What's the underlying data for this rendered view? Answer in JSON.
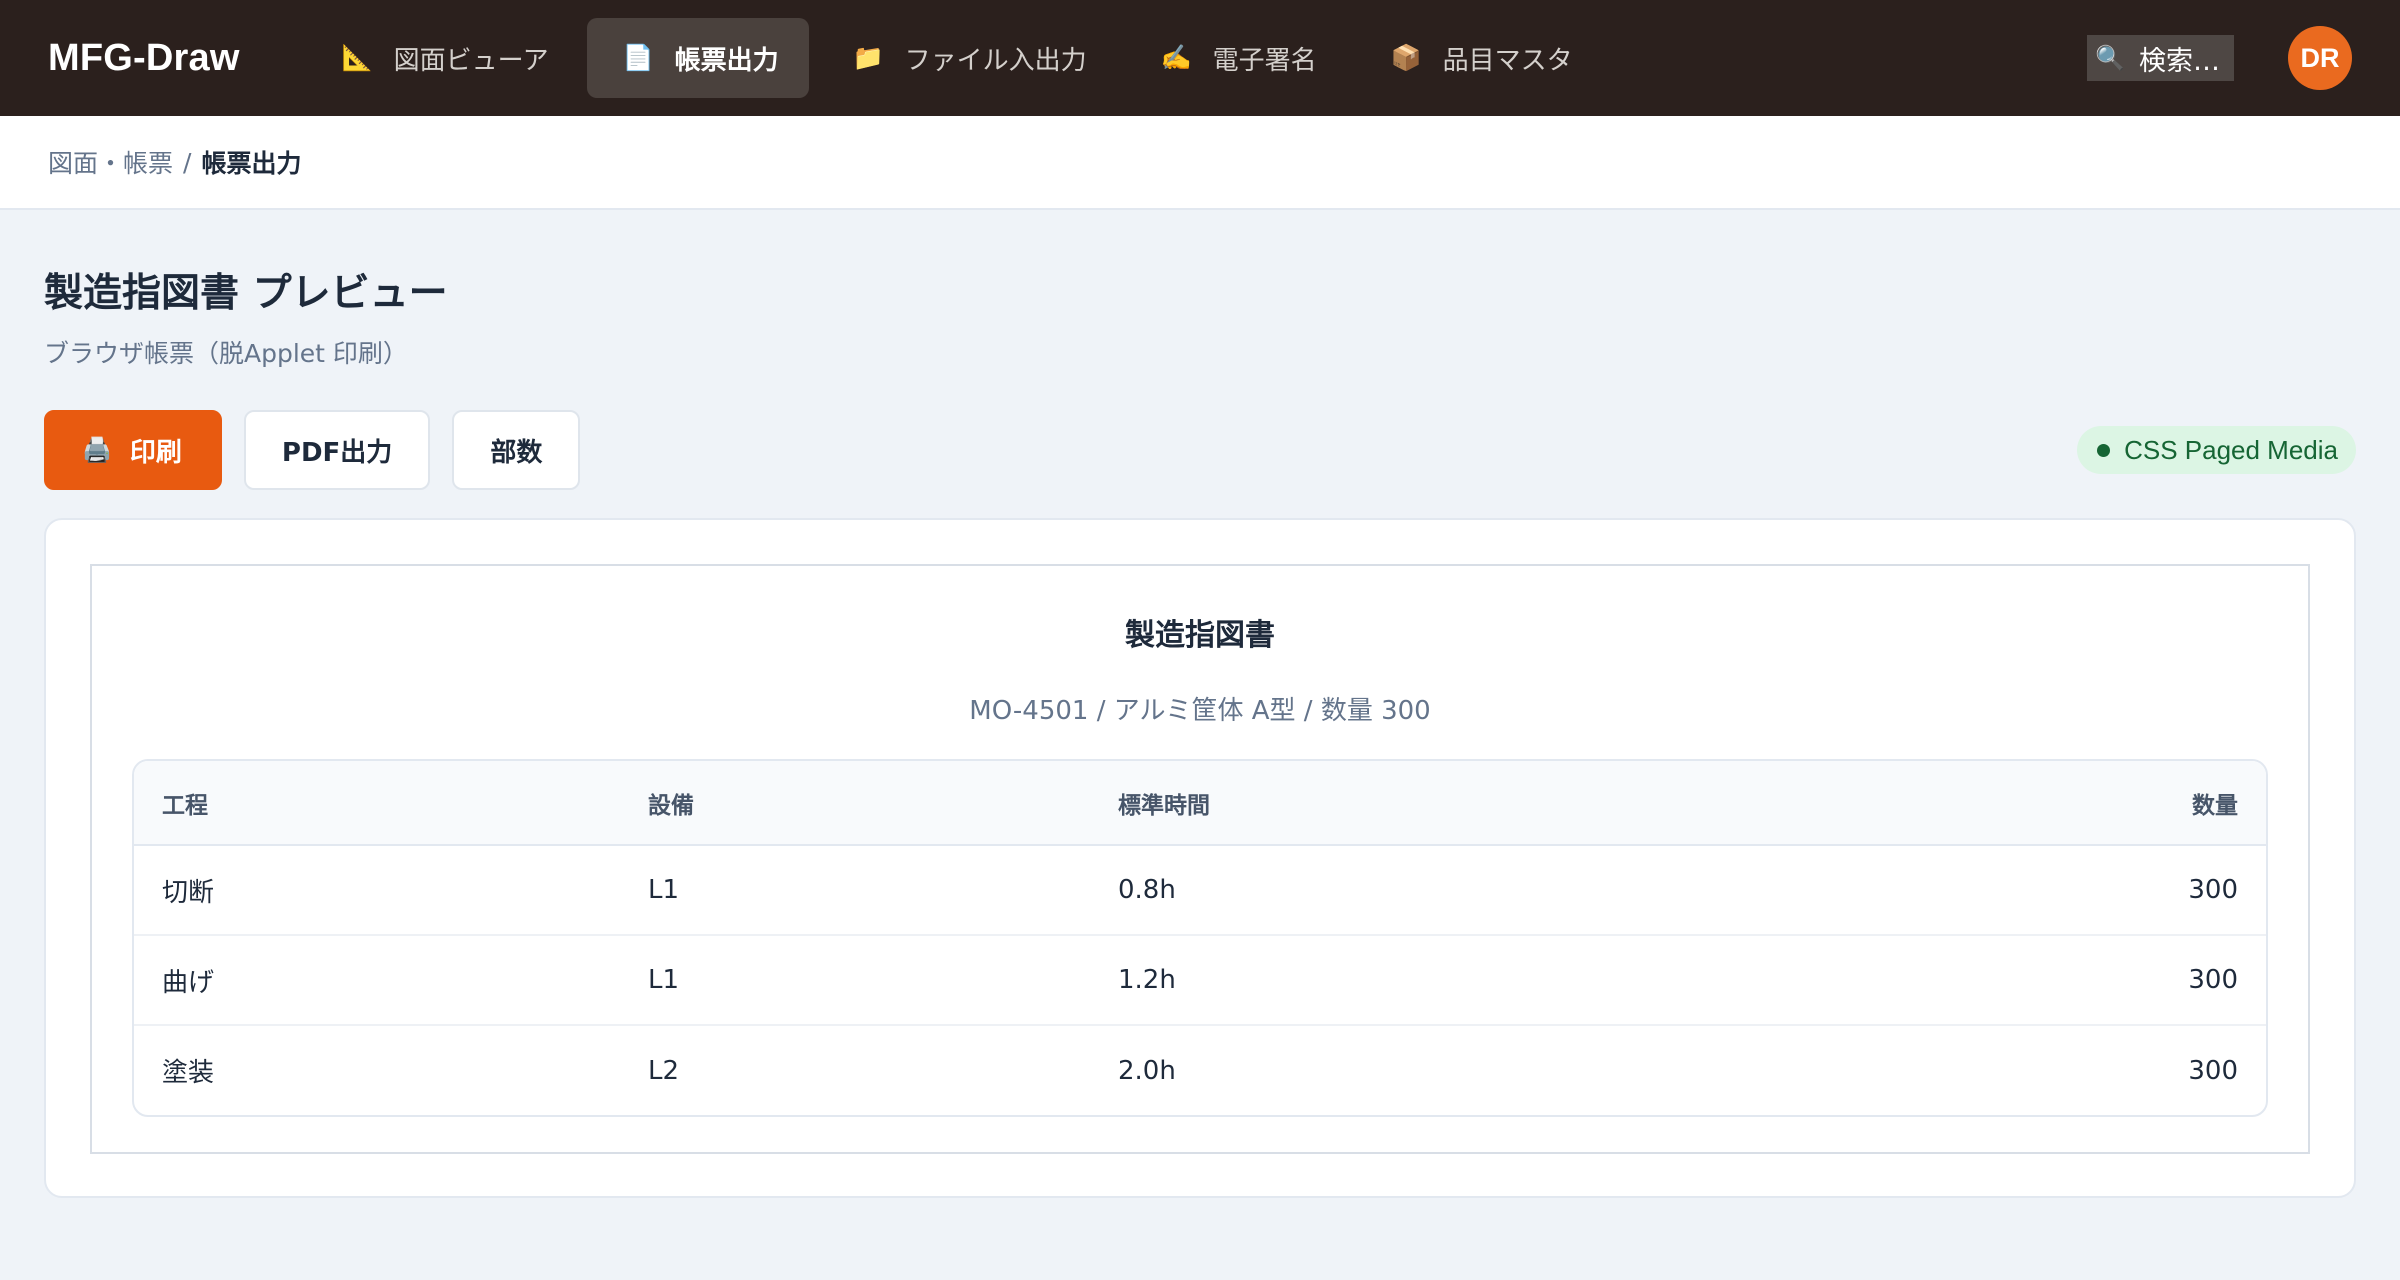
{
  "app": {
    "brand": "MFG-Draw",
    "nav": [
      {
        "label": "図面ビューア",
        "icon": "📐"
      },
      {
        "label": "帳票出力",
        "icon": "📄",
        "active": true
      },
      {
        "label": "ファイル入出力",
        "icon": "📁"
      },
      {
        "label": "電子署名",
        "icon": "✍️"
      },
      {
        "label": "品目マスタ",
        "icon": "📦"
      }
    ],
    "search_label": "検索…",
    "search_icon": "🔍",
    "avatar_initials": "DR"
  },
  "breadcrumb": {
    "parent": "図面・帳票",
    "separator": "/",
    "current": "帳票出力"
  },
  "page": {
    "title": "製造指図書 プレビュー",
    "subtitle": "ブラウザ帳票（脱Applet 印刷）"
  },
  "actions": {
    "print_icon": "🖨️",
    "print_label": "印刷",
    "pdf_label": "PDF出力",
    "copies_label": "部数",
    "badge_label": "CSS Paged Media",
    "badge_color": "#166534"
  },
  "document": {
    "title": "製造指図書",
    "meta": "MO-4501 / アルミ筐体 A型 / 数量 300",
    "columns": [
      "工程",
      "設備",
      "標準時間",
      "数量"
    ],
    "rows": [
      [
        "切断",
        "L1",
        "0.8h",
        "300"
      ],
      [
        "曲げ",
        "L1",
        "1.2h",
        "300"
      ],
      [
        "塗装",
        "L2",
        "2.0h",
        "300"
      ]
    ]
  },
  "colors": {
    "topbar": "#2b201d",
    "accent": "#e85a10",
    "avatar": "#ea6a1f"
  }
}
